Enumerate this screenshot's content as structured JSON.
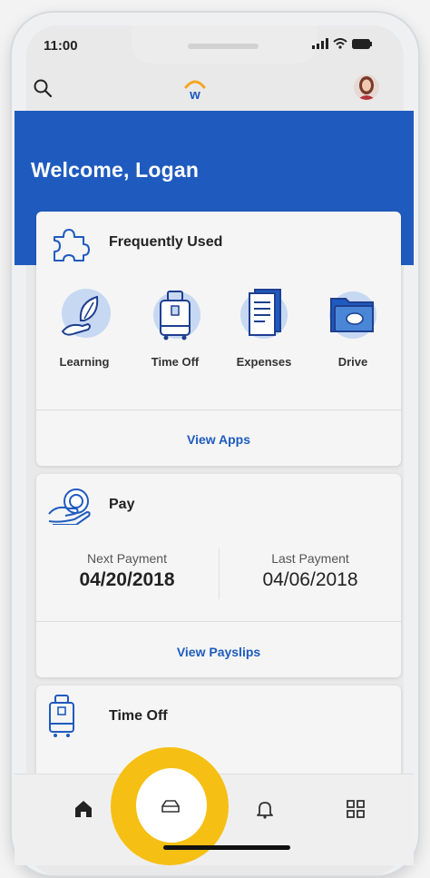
{
  "status_bar": {
    "time": "11:00"
  },
  "header": {
    "welcome": "Welcome, Logan"
  },
  "frequently_used": {
    "title": "Frequently Used",
    "apps": [
      {
        "label": "Learning",
        "icon": "leaf-hand-icon"
      },
      {
        "label": "Time Off",
        "icon": "luggage-icon"
      },
      {
        "label": "Expenses",
        "icon": "receipt-icon"
      },
      {
        "label": "Drive",
        "icon": "folder-cloud-icon"
      }
    ],
    "view_apps": "View Apps"
  },
  "pay": {
    "title": "Pay",
    "next_payment_label": "Next Payment",
    "next_payment_date": "04/20/2018",
    "last_payment_label": "Last Payment",
    "last_payment_date": "04/06/2018",
    "view_payslips": "View Payslips"
  },
  "time_off": {
    "title": "Time Off"
  },
  "colors": {
    "brand_blue": "#1f5bbf",
    "highlight": "#f6bf13"
  }
}
